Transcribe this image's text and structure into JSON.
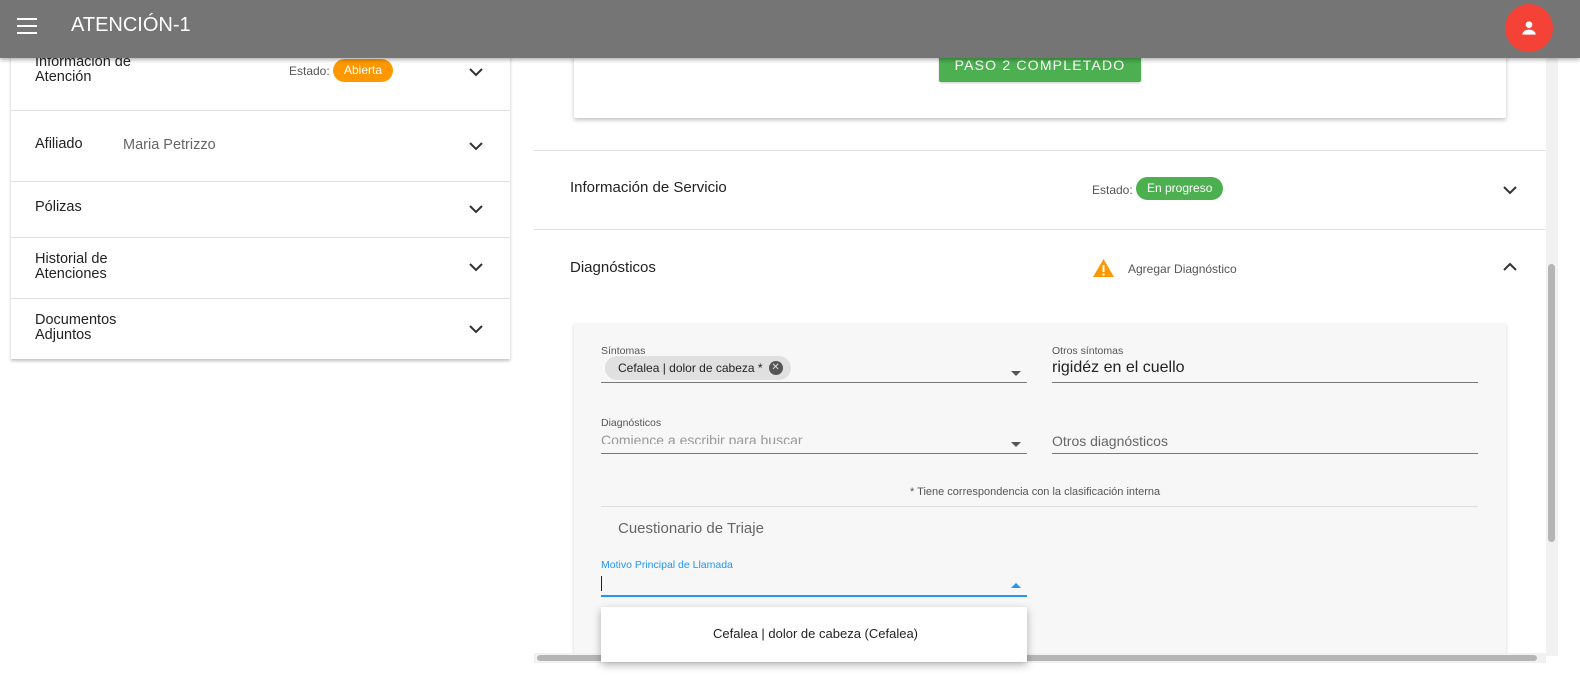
{
  "appbar": {
    "title": "ATENCIÓN-1",
    "menu_icon": "menu-icon",
    "avatar_icon": "person-icon",
    "avatar_color": "#f44336"
  },
  "left_panel": {
    "info": {
      "title_line1": "Información de",
      "title_line2": "Atención",
      "estado_label": "Estado:",
      "estado_value": "Abierta"
    },
    "afiliado": {
      "title": "Afiliado",
      "value": "Maria Petrizzo"
    },
    "polizas": {
      "title": "Pólizas"
    },
    "historial": {
      "title_line1": "Historial de",
      "title_line2": "Atenciones"
    },
    "documentos": {
      "title_line1": "Documentos",
      "title_line2": "Adjuntos"
    }
  },
  "step": {
    "button_label": "PASO 2 COMPLETADO"
  },
  "servicio": {
    "title": "Información de Servicio",
    "estado_label": "Estado:",
    "estado_value": "En progreso"
  },
  "diagnosticos_section": {
    "title": "Diagnósticos",
    "warning_icon": "warning-icon",
    "action_label": "Agregar Diagnóstico"
  },
  "form": {
    "sintomas": {
      "label": "Síntomas",
      "chip": "Cefalea | dolor de cabeza *"
    },
    "otros_sintomas": {
      "label": "Otros síntomas",
      "value": "rigidéz en el cuello"
    },
    "diagnosticos": {
      "label": "Diagnósticos",
      "placeholder": "Comience a escribir para buscar"
    },
    "otros_diagnosticos": {
      "placeholder": "Otros diagnósticos"
    },
    "note": "* Tiene correspondencia con la clasificación interna",
    "cuestionario_title": "Cuestionario de Triaje",
    "motivo": {
      "label": "Motivo Principal de Llamada",
      "value": ""
    },
    "dropdown_options": [
      "Cefalea | dolor de cabeza (Cefalea)"
    ]
  },
  "colors": {
    "appbar": "#757575",
    "accent_blue": "#2196f3",
    "green": "#4caf50",
    "orange": "#ff9800"
  }
}
